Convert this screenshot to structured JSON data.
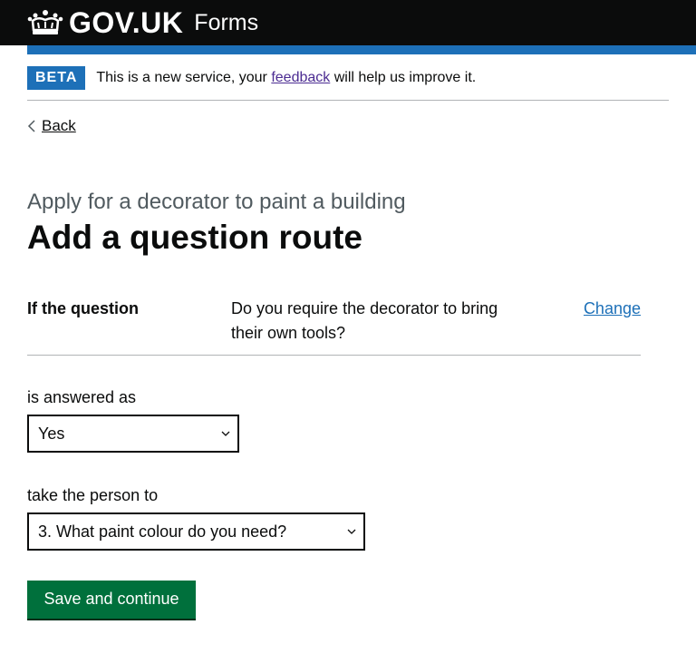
{
  "header": {
    "logo_text": "GOV.UK",
    "service_name": "Forms"
  },
  "phase_banner": {
    "tag": "BETA",
    "text_before": "This is a new service, your ",
    "link": "feedback",
    "text_after": " will help us improve it."
  },
  "back_link": "Back",
  "caption": "Apply for a decorator to paint a building",
  "title": "Add a question route",
  "summary": {
    "key": "If the question",
    "value": "Do you require the decorator to bring their own tools?",
    "action": "Change"
  },
  "answer_field": {
    "label": "is answered as",
    "selected": "Yes"
  },
  "destination_field": {
    "label": "take the person to",
    "selected": "3. What paint colour do you need?"
  },
  "submit_button": "Save and continue",
  "colors": {
    "header_bg": "#0b0c0c",
    "brand_blue": "#1d70b8",
    "button_green": "#00703c",
    "visited_link": "#4c2c92"
  },
  "icons": [
    "crown-icon",
    "chevron-left-icon",
    "chevron-down-icon"
  ]
}
